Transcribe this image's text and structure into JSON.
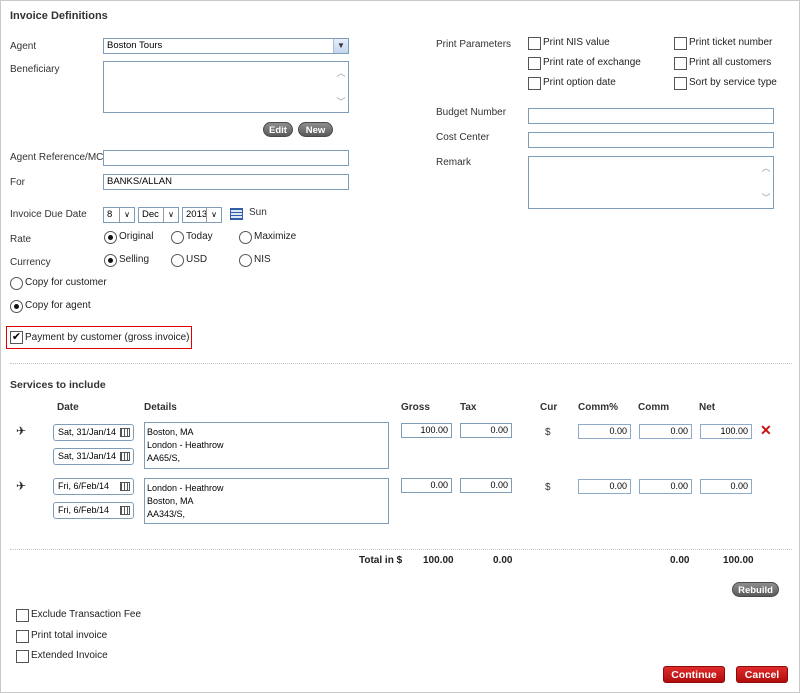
{
  "section_title": "Invoice Definitions",
  "agent": {
    "label": "Agent",
    "value": "Boston Tours"
  },
  "beneficiary": {
    "label": "Beneficiary",
    "edit": "Edit",
    "new": "New"
  },
  "agent_ref": {
    "label": "Agent Reference/MCO",
    "value": ""
  },
  "for_field": {
    "label": "For",
    "value": "BANKS/ALLAN"
  },
  "due_date": {
    "label": "Invoice Due Date",
    "day": "8",
    "month": "Dec",
    "year": "2013",
    "weekday": "Sun"
  },
  "rate": {
    "label": "Rate",
    "options": [
      "Original",
      "Today",
      "Maximize"
    ],
    "selected": "Original"
  },
  "currency": {
    "label": "Currency",
    "options": [
      "Selling",
      "USD",
      "NIS"
    ],
    "selected": "Selling"
  },
  "copy_options": {
    "customer": "Copy for customer",
    "agent": "Copy for agent",
    "selected": "agent"
  },
  "payment_by_customer": {
    "label": "Payment by customer (gross invoice)",
    "checked": true
  },
  "print_parameters": {
    "label": "Print Parameters",
    "items": [
      "Print NIS value",
      "Print ticket number",
      "Print rate of exchange",
      "Print all customers",
      "Print option date",
      "Sort by service type"
    ]
  },
  "budget_number": {
    "label": "Budget Number",
    "value": ""
  },
  "cost_center": {
    "label": "Cost Center",
    "value": ""
  },
  "remark": {
    "label": "Remark"
  },
  "services": {
    "title": "Services to include",
    "headers": {
      "date": "Date",
      "details": "Details",
      "gross": "Gross",
      "tax": "Tax",
      "cur": "Cur",
      "comm_pct": "Comm%",
      "comm": "Comm",
      "net": "Net"
    },
    "rows": [
      {
        "icon": "airplane-icon",
        "dates": [
          "Sat, 31/Jan/14",
          "Sat, 31/Jan/14"
        ],
        "details": [
          "Boston, MA",
          "London - Heathrow",
          "AA65/S,"
        ],
        "gross": "100.00",
        "tax": "0.00",
        "cur": "$",
        "comm_pct": "0.00",
        "comm": "0.00",
        "net": "100.00"
      },
      {
        "icon": "airplane-icon",
        "dates": [
          "Fri, 6/Feb/14",
          "Fri, 6/Feb/14"
        ],
        "details": [
          "London - Heathrow",
          "Boston, MA",
          "AA343/S,"
        ],
        "gross": "0.00",
        "tax": "0.00",
        "cur": "$",
        "comm_pct": "0.00",
        "comm": "0.00",
        "net": "0.00"
      }
    ],
    "totals": {
      "label": "Total in $",
      "gross": "100.00",
      "tax": "0.00",
      "comm": "0.00",
      "net": "100.00"
    },
    "rebuild": "Rebuild"
  },
  "bottom_options": [
    "Exclude Transaction Fee",
    "Print total invoice",
    "Extended Invoice"
  ],
  "actions": {
    "continue": "Continue",
    "cancel": "Cancel"
  },
  "colors": {
    "accent_red": "#cc1111",
    "highlight_border": "#e00000",
    "input_border": "#7f9db9"
  }
}
